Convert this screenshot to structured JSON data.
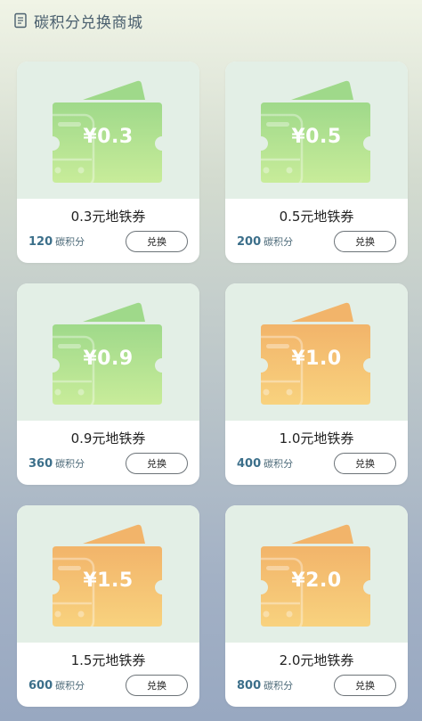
{
  "header": {
    "title": "碳积分兑换商城",
    "icon": "receipt-icon"
  },
  "colors": {
    "green_light": "#c8ec9a",
    "green_dark": "#9fd98a",
    "orange_light": "#f8d27e",
    "orange_dark": "#f2b46a",
    "card_image_bg": "#e3efe6",
    "points_color": "#3c6f8a"
  },
  "points_unit": "碳积分",
  "button_label": "兑换",
  "vouchers": [
    {
      "value": "¥0.3",
      "title": "0.3元地铁券",
      "points": "120",
      "theme": "green"
    },
    {
      "value": "¥0.5",
      "title": "0.5元地铁券",
      "points": "200",
      "theme": "green"
    },
    {
      "value": "¥0.9",
      "title": "0.9元地铁券",
      "points": "360",
      "theme": "green"
    },
    {
      "value": "¥1.0",
      "title": "1.0元地铁券",
      "points": "400",
      "theme": "orange"
    },
    {
      "value": "¥1.5",
      "title": "1.5元地铁券",
      "points": "600",
      "theme": "orange"
    },
    {
      "value": "¥2.0",
      "title": "2.0元地铁券",
      "points": "800",
      "theme": "orange"
    }
  ]
}
